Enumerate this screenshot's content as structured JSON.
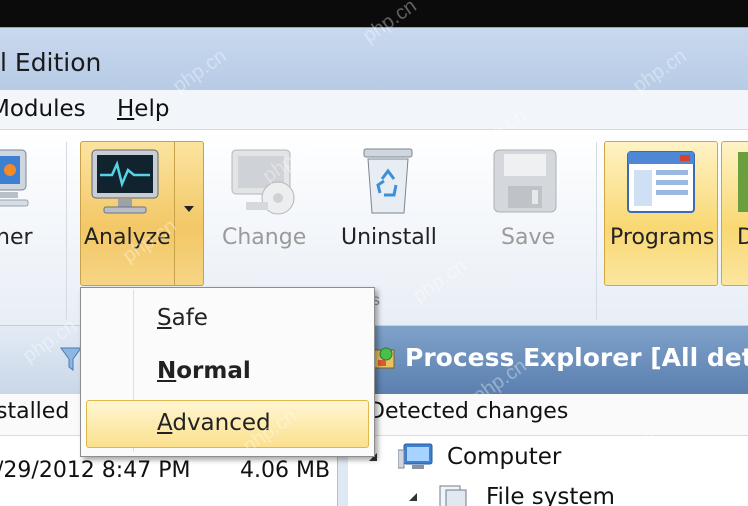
{
  "window": {
    "title": "l Edition"
  },
  "menu": [
    {
      "label": "Modules",
      "underline": "",
      "rest": "Modules",
      "display_start": "odules"
    },
    {
      "label": "Help",
      "underline": "H",
      "rest": "elp"
    }
  ],
  "ribbon": {
    "buttons": {
      "cleaner": "ner",
      "analyze": "Analyze",
      "change": "Change",
      "uninstall": "Uninstall",
      "save": "Save",
      "programs": "Programs",
      "d_partial": "D"
    },
    "group_label_partial": "s"
  },
  "dropdown": {
    "items": [
      {
        "underline": "S",
        "rest": "afe",
        "bold": false
      },
      {
        "underline": "N",
        "rest": "ormal",
        "bold": true
      },
      {
        "underline": "A",
        "rest": "dvanced",
        "bold": false,
        "highlighted": true
      }
    ]
  },
  "left_pane": {
    "columns": {
      "installed": "stalled"
    },
    "row": {
      "date": "/29/2012 8:47 PM",
      "size": "4.06 MB"
    }
  },
  "right_pane": {
    "title": "Process Explorer [All deta",
    "column": "Detected changes",
    "tree": [
      {
        "label": "Computer"
      },
      {
        "label": "File system"
      }
    ]
  },
  "watermark": "php.cn",
  "colors": {
    "highlight": "#f3c766",
    "header_blue": "#5b80b0"
  }
}
